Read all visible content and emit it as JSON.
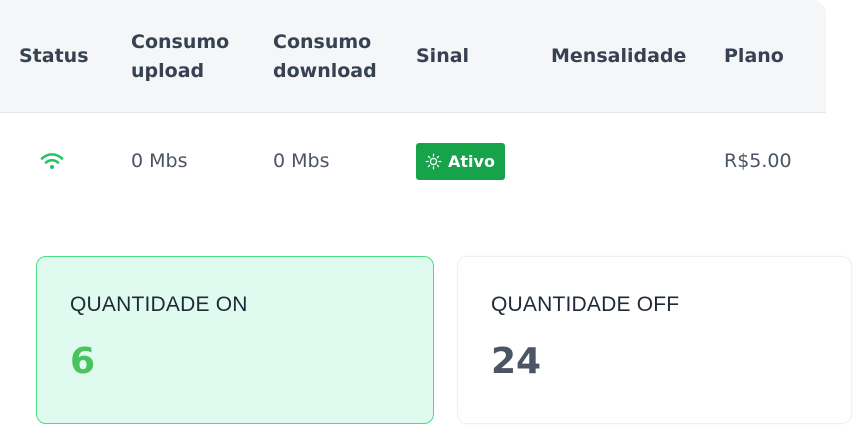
{
  "table": {
    "headers": {
      "status": "Status",
      "upload": [
        "Consumo",
        "upload"
      ],
      "download": [
        "Consumo",
        "download"
      ],
      "sinal": "Sinal",
      "mensalidade": "Mensalidade",
      "plano": "Plano"
    },
    "rows": [
      {
        "status_icon": "wifi-icon",
        "upload": "0 Mbs",
        "download": "0 Mbs",
        "sinal": {
          "icon": "sun-icon",
          "label": "Ativo"
        },
        "mensalidade": "",
        "plano": "R$5.00"
      }
    ]
  },
  "cards": {
    "on": {
      "label": "QUANTIDADE ON",
      "value": "6"
    },
    "off": {
      "label": "QUANTIDADE OFF",
      "value": "24"
    }
  },
  "colors": {
    "status_active": "#16a34a",
    "wifi": "#22c55e",
    "card_on_bg": "#dffbef",
    "card_on_border": "#4ade80",
    "card_on_value": "#4ac35c",
    "header_bg": "#f5f6f8"
  }
}
